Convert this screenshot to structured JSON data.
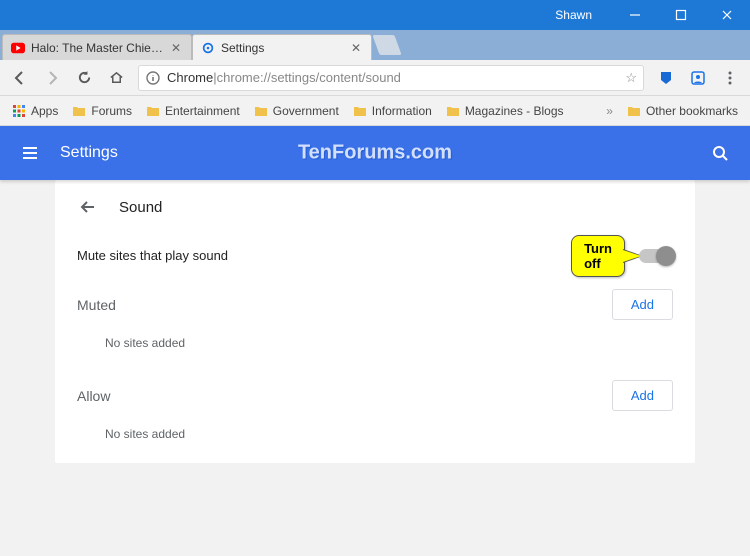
{
  "window": {
    "user": "Shawn"
  },
  "tabs": [
    {
      "title": "Halo: The Master Chief C",
      "active": false
    },
    {
      "title": "Settings",
      "active": true
    }
  ],
  "address": {
    "origin": "Chrome",
    "sep": " | ",
    "path": "chrome://settings/content/sound"
  },
  "bookmarks": {
    "apps": "Apps",
    "items": [
      "Forums",
      "Entertainment",
      "Government",
      "Information",
      "Magazines - Blogs"
    ],
    "overflow": "»",
    "other": "Other bookmarks"
  },
  "header": {
    "title": "Settings",
    "watermark": "TenForums.com"
  },
  "page": {
    "back_label": "Sound",
    "main_toggle_label": "Mute sites that play sound",
    "callout": "Turn off",
    "sections": {
      "muted": {
        "title": "Muted",
        "add": "Add",
        "empty": "No sites added"
      },
      "allow": {
        "title": "Allow",
        "add": "Add",
        "empty": "No sites added"
      }
    }
  }
}
